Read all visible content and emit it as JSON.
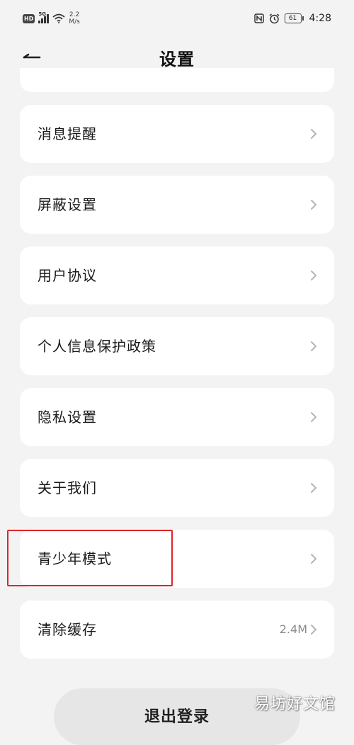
{
  "status_bar": {
    "hd": "HD",
    "network": "5G",
    "speed_value": "2.2",
    "speed_unit": "M/s",
    "battery": "61",
    "time": "4:28",
    "icons": [
      "signal-icon",
      "wifi-icon",
      "nfc-icon",
      "alarm-icon",
      "battery-icon"
    ]
  },
  "header": {
    "title": "设置",
    "back_icon": "back-arrow-icon"
  },
  "menu": {
    "items": [
      {
        "label": "消息提醒"
      },
      {
        "label": "屏蔽设置"
      },
      {
        "label": "用户协议"
      },
      {
        "label": "个人信息保护政策"
      },
      {
        "label": "隐私设置"
      },
      {
        "label": "关于我们"
      },
      {
        "label": "青少年模式",
        "highlighted": true
      },
      {
        "label": "清除缓存",
        "value": "2.4M"
      }
    ]
  },
  "logout": {
    "label": "退出登录"
  },
  "watermark": {
    "text": "易坊好文馆"
  },
  "colors": {
    "background": "#f3f3f3",
    "card": "#ffffff",
    "highlight": "#e0242c",
    "logout_bg": "#e6e6e6"
  }
}
